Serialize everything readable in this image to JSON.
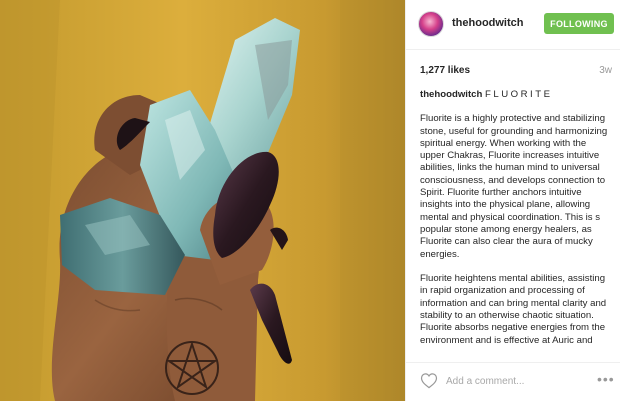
{
  "post": {
    "username": "thehoodwitch",
    "follow_label": "FOLLOWING",
    "likes": "1,277 likes",
    "time": "3w",
    "caption_user": "thehoodwitch",
    "caption_title": "FLUORITE",
    "paragraphs": [
      "Fluorite is a highly protective and stabilizing stone, useful for grounding and harmonizing spiritual energy. When working with the upper Chakras, Fluorite increases intuitive abilities, links the human mind to universal consciousness, and develops connection to Spirit. Fluorite further anchors intuitive insights into the physical plane, allowing mental and physical coordination. This is s popular stone among energy healers, as Fluorite can also clear the aura of mucky energies.",
      "Fluorite heightens mental abilities, assisting in rapid organization and processing of information and can bring mental clarity and stability to an otherwise chaotic situation. Fluorite absorbs negative energies from the environment and is effective at Auric and"
    ],
    "comment_placeholder": "Add a comment...",
    "colors": {
      "follow_button": "#70c050",
      "text": "#262626",
      "muted": "#999999",
      "divider": "#efefef"
    },
    "icons": [
      "heart-icon",
      "more-options-icon"
    ]
  }
}
